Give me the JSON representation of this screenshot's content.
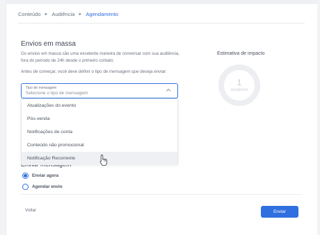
{
  "breadcrumb": {
    "items": [
      "Conteúdo",
      "Audiência",
      "Agendamento"
    ],
    "separator": "►"
  },
  "section": {
    "title": "Envios em massa",
    "description": "Os envios em massa são uma excelente maneira de conversar com sua audiência, fora do período de 24h desde o primeiro contato.",
    "instruction": "Antes de começar, você deve definir o tipo de mensagem que deseja enviar:"
  },
  "impact": {
    "label": "Estimativa de impacto",
    "count": "1",
    "unit": "usuários"
  },
  "message_type": {
    "label": "Tipo de mensagem",
    "placeholder": "Selecione o tipo de mensagem",
    "options": [
      "Atualizações do evento",
      "Pós-venda",
      "Notificações de conta",
      "Conteúdo não promocional",
      "Notificação Recorrente"
    ],
    "hovered": "Notificação Recorrente"
  },
  "send": {
    "title": "Enviar mensagem",
    "options": [
      {
        "label": "Enviar agora",
        "selected": true
      },
      {
        "label": "Agendar envio",
        "selected": false
      }
    ]
  },
  "footer": {
    "back_label": "Voltar",
    "send_label": "Enviar"
  },
  "colors": {
    "accent": "#2f6fe0",
    "ring": "#eceef1",
    "hover": "#eef0f3"
  },
  "icons": {
    "chevron": "chevron-up-icon",
    "cursor": "hand-pointer-icon"
  }
}
